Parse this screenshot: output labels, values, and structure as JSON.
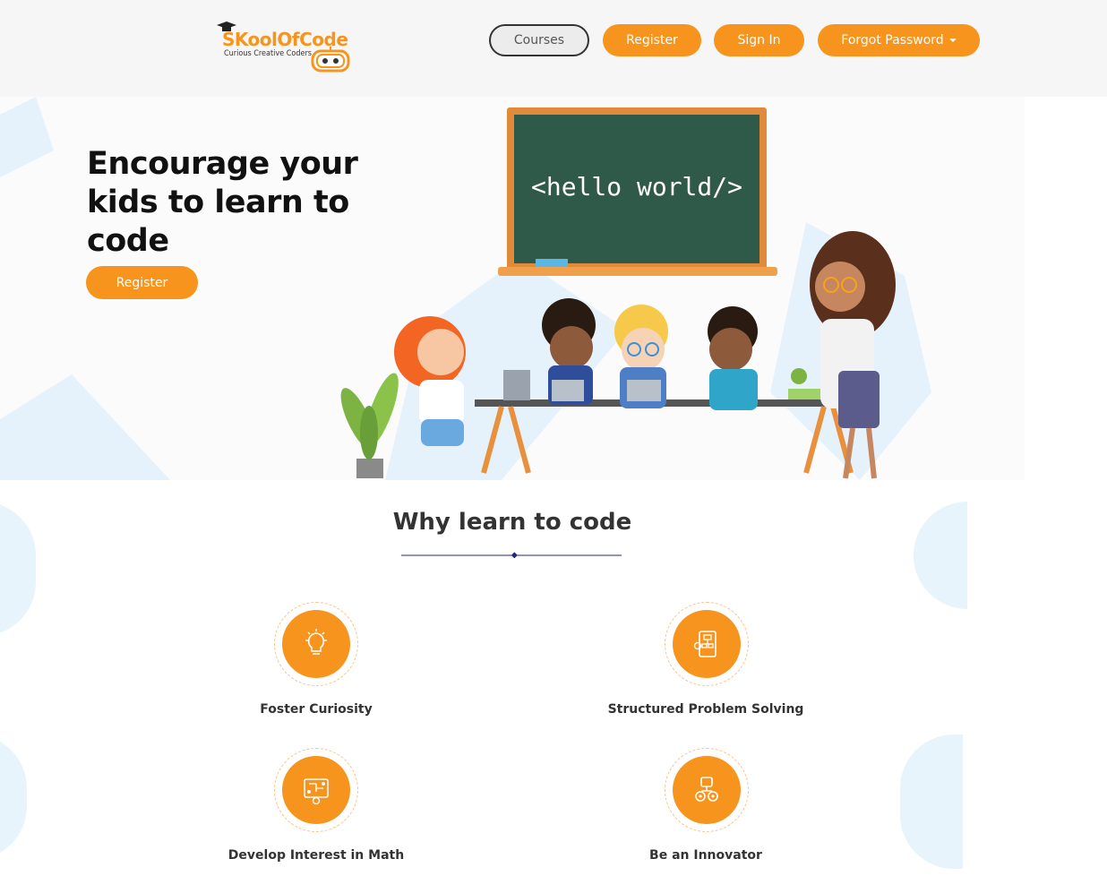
{
  "brand": {
    "name": "SKoolOfCode",
    "tagline": "Curious Creative Coders",
    "accent_color": "#f7941d"
  },
  "nav": {
    "courses": "Courses",
    "register": "Register",
    "sign_in": "Sign In",
    "forgot_password": "Forgot Password"
  },
  "hero": {
    "title": "Encourage your kids to learn to code",
    "register_button": "Register",
    "board_text": "<hello world/>"
  },
  "why": {
    "title": "Why learn to code",
    "features": [
      {
        "label": "Foster Curiosity",
        "icon": "lightbulb-icon"
      },
      {
        "label": "Structured Problem Solving",
        "icon": "flowchart-icon"
      },
      {
        "label": "Develop Interest in Math",
        "icon": "circuit-board-icon"
      },
      {
        "label": "Be an Innovator",
        "icon": "robot-gears-icon"
      }
    ]
  }
}
